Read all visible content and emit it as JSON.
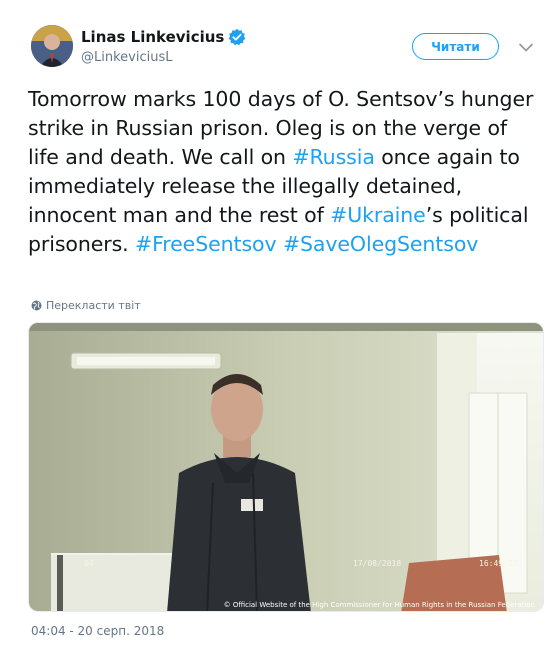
{
  "author": {
    "display_name": "Linas Linkevicius",
    "handle": "@LinkeviciusL",
    "verified_icon": "verified-badge-icon",
    "avatar_icon": "avatar"
  },
  "actions": {
    "follow_label": "Читати",
    "more_icon": "chevron-down-icon"
  },
  "tweet": {
    "segments": [
      {
        "text": "Tomorrow marks 100 days of O. Sentsov’s hunger strike in Russian prison. Oleg is on the verge of life and death. We call on ",
        "type": "text"
      },
      {
        "text": "#Russia",
        "type": "hashtag"
      },
      {
        "text": " once again to immediately release the illegally detained, innocent man and the rest of ",
        "type": "text"
      },
      {
        "text": "#Ukraine",
        "type": "hashtag"
      },
      {
        "text": "’s political prisoners. ",
        "type": "text"
      },
      {
        "text": "#FreeSentsov",
        "type": "hashtag"
      },
      {
        "text": " ",
        "type": "text"
      },
      {
        "text": "#SaveOlegSentsov",
        "type": "hashtag"
      }
    ]
  },
  "translate": {
    "label": "Перекласти твіт",
    "icon": "globe-icon"
  },
  "media": {
    "credit": "© Official Website of the High Commissioner for Human Rights in the Russian Federation",
    "cam_date": "17/08/2018",
    "cam_time": "16:49:23",
    "cam_tag": "04"
  },
  "meta": {
    "timestamp": "04:04 - 20 серп. 2018"
  },
  "colors": {
    "accent": "#1da1f2",
    "text": "#14171a",
    "secondary": "#657786"
  }
}
